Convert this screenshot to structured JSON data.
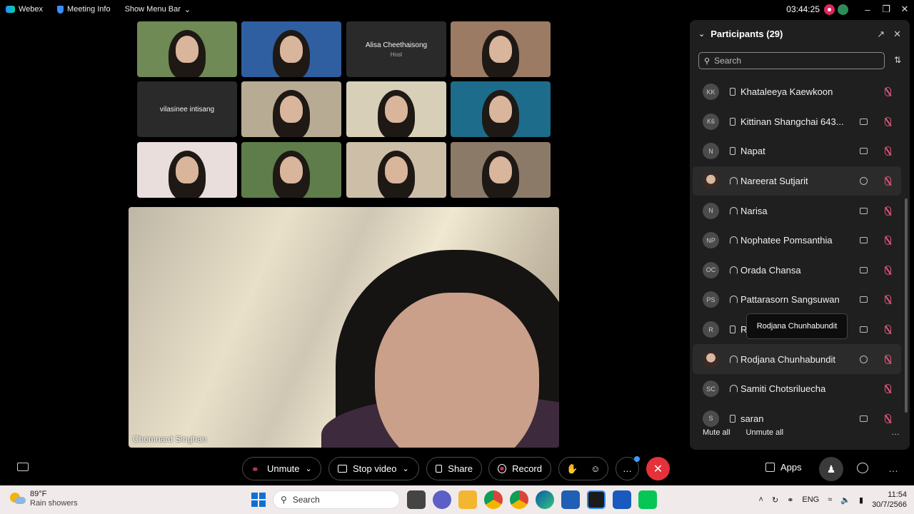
{
  "titlebar": {
    "app_name": "Webex",
    "meeting_info": "Meeting Info",
    "show_menu_bar": "Show Menu Bar",
    "clock": "03:44:25"
  },
  "grid_tiles": [
    {
      "type": "video",
      "bg": "#6f8a54"
    },
    {
      "type": "video",
      "bg": "#2f5fa0"
    },
    {
      "type": "name",
      "name": "Alisa Cheethaisong",
      "role": "Host"
    },
    {
      "type": "video",
      "bg": "#9b7b63"
    },
    {
      "type": "name",
      "name": "vilasinee intisang",
      "role": ""
    },
    {
      "type": "video",
      "bg": "#b8ab93"
    },
    {
      "type": "video",
      "bg": "#d8cfb8"
    },
    {
      "type": "video",
      "bg": "#1d6c8c"
    },
    {
      "type": "video",
      "bg": "#e9dedc"
    },
    {
      "type": "video",
      "bg": "#5e7d4a"
    },
    {
      "type": "video",
      "bg": "#cdbfa7"
    },
    {
      "type": "video",
      "bg": "#8c7a69"
    }
  ],
  "main_video": {
    "name": "Chomnard Singhan"
  },
  "participants": {
    "title": "Participants (29)",
    "search_placeholder": "Search",
    "list": [
      {
        "initials": "KK",
        "name": "Khataleeya Kaewkoon",
        "device": "phone",
        "video": false,
        "chat": false,
        "highlight": false
      },
      {
        "initials": "K6",
        "name": "Kittinan Shangchai 643...",
        "device": "phone",
        "video": true,
        "chat": false,
        "highlight": false
      },
      {
        "initials": "N",
        "name": "Napat",
        "device": "phone",
        "video": true,
        "chat": false,
        "highlight": false
      },
      {
        "initials": "",
        "name": "Nareerat Sutjarit",
        "device": "audio",
        "video": false,
        "chat": true,
        "highlight": true,
        "photo": true
      },
      {
        "initials": "N",
        "name": "Narisa",
        "device": "audio",
        "video": true,
        "chat": false,
        "highlight": false
      },
      {
        "initials": "NP",
        "name": "Nophatee Pomsanthia",
        "device": "audio",
        "video": true,
        "chat": false,
        "highlight": false
      },
      {
        "initials": "OC",
        "name": "Orada Chansa",
        "device": "audio",
        "video": true,
        "chat": false,
        "highlight": false
      },
      {
        "initials": "PS",
        "name": "Pattarasorn Sangsuwan",
        "device": "audio",
        "video": true,
        "chat": false,
        "highlight": false
      },
      {
        "initials": "R",
        "name": "R",
        "device": "phone",
        "video": true,
        "chat": false,
        "highlight": false
      },
      {
        "initials": "",
        "name": "Rodjana Chunhabundit",
        "device": "audio",
        "video": false,
        "chat": true,
        "highlight": true,
        "photo": true
      },
      {
        "initials": "SC",
        "name": "Samiti Chotsriluecha",
        "device": "audio",
        "video": false,
        "chat": false,
        "highlight": false
      },
      {
        "initials": "S",
        "name": "saran",
        "device": "phone",
        "video": true,
        "chat": false,
        "highlight": false
      }
    ],
    "mute_all": "Mute all",
    "unmute_all": "Unmute all",
    "tooltip": "Rodjana Chunhabundit"
  },
  "controls": {
    "unmute": "Unmute",
    "stop_video": "Stop video",
    "share": "Share",
    "record": "Record",
    "apps": "Apps"
  },
  "taskbar": {
    "temp": "89°F",
    "weather": "Rain showers",
    "search": "Search",
    "lang": "ENG",
    "time": "11:54",
    "date": "30/7/2566"
  }
}
